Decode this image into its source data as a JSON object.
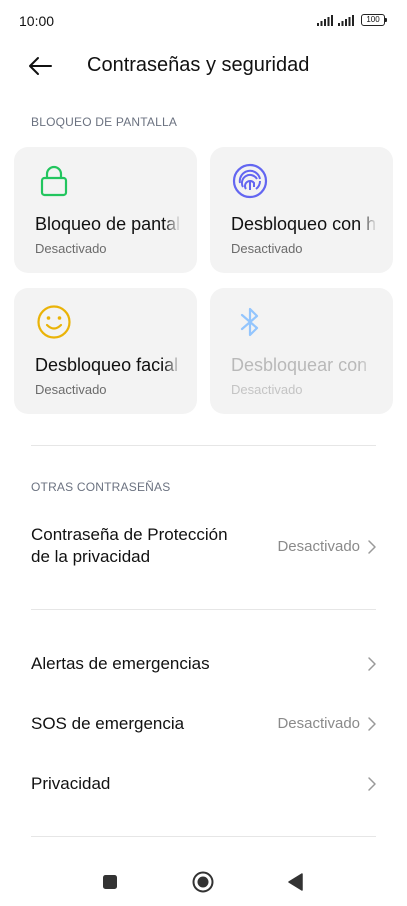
{
  "status_bar": {
    "time": "10:00",
    "signal_icon": "cellular-signal-icon",
    "battery_level": "100"
  },
  "header": {
    "back_icon": "arrow-left-icon",
    "title": "Contraseñas y seguridad"
  },
  "screen_lock": {
    "section_label": "BLOQUEO DE PANTALLA",
    "cards": [
      {
        "icon": "lock-icon",
        "title": "Bloqueo de pantalla",
        "status": "Desactivado",
        "enabled": true,
        "icon_color": "#22c55e"
      },
      {
        "icon": "fingerprint-icon",
        "title": "Desbloqueo con huella",
        "status": "Desactivado",
        "enabled": true,
        "icon_color": "#6366f1"
      },
      {
        "icon": "face-icon",
        "title": "Desbloqueo facial",
        "status": "Desactivado",
        "enabled": true,
        "icon_color": "#eab308"
      },
      {
        "icon": "bluetooth-icon",
        "title": "Desbloquear con",
        "status": "Desactivado",
        "enabled": false,
        "icon_color": "#93c5fd"
      }
    ]
  },
  "other_passwords": {
    "section_label": "OTRAS CONTRASEÑAS",
    "privacy_protection": {
      "label_line1": "Contraseña de Protección",
      "label_line2": "de la privacidad",
      "value": "Desactivado"
    }
  },
  "rows": [
    {
      "label": "Alertas de emergencias",
      "value": ""
    },
    {
      "label": "SOS de emergencia",
      "value": "Desactivado"
    },
    {
      "label": "Privacidad",
      "value": ""
    }
  ],
  "navigation": {
    "recents_icon": "square-icon",
    "home_icon": "circle-home-icon",
    "back_icon": "triangle-back-icon"
  }
}
